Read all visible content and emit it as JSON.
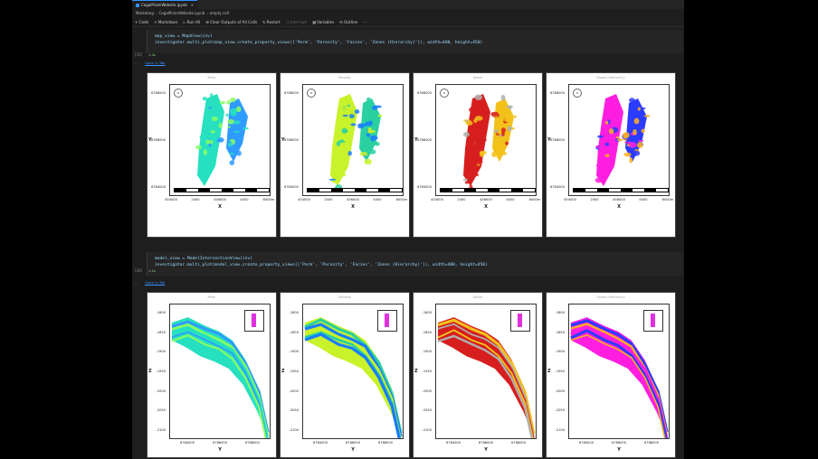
{
  "tab": {
    "filename": "CegalPrizmWebsite.ipynb"
  },
  "breadcrumb": [
    "Marketing",
    "CegalPrizmWebsite.ipynb",
    "empty cell"
  ],
  "toolbar": [
    {
      "label": "Code",
      "icon": "plus-icon",
      "enabled": true
    },
    {
      "label": "Markdown",
      "icon": "plus-icon",
      "enabled": true
    },
    {
      "label": "Run All",
      "icon": "run-all-icon",
      "enabled": true
    },
    {
      "label": "Clear Outputs of All Cells",
      "icon": "clear-icon",
      "enabled": true
    },
    {
      "label": "Restart",
      "icon": "restart-icon",
      "enabled": true
    },
    {
      "label": "Interrupt",
      "icon": "stop-icon",
      "enabled": false
    },
    {
      "label": "Variables",
      "icon": "variables-icon",
      "enabled": true
    },
    {
      "label": "Outline",
      "icon": "outline-icon",
      "enabled": true
    }
  ],
  "cells": [
    {
      "exec_count": "[35]",
      "status": "1.4s",
      "code_line1": "map_view = MapView(inv)",
      "code_line2": "investigator.multi_plot(map_view.create_property_views(['Perm', 'Porosity', 'Facies', 'Zones (Hierarchy)']), width=400, height=450)",
      "out_link": "Open in Tab",
      "panels": [
        {
          "title": "Perm"
        },
        {
          "title": "Porosity"
        },
        {
          "title": "Facies"
        },
        {
          "title": "Zones (Hierarchy)"
        }
      ],
      "yticks": [
        "6788000",
        "6786000",
        "6784000"
      ],
      "ylabel": "Y",
      "xticks": [
        "454000",
        "2000",
        "456000",
        "4000",
        "6000m"
      ],
      "xlabel": "X"
    },
    {
      "exec_count": "[36]",
      "status": "1.2s",
      "code_line1": "model_view = ModelIntersectionView(inv)",
      "code_line2": "investigator.multi_plot(model_view.create_property_views(['Perm', 'Porosity', 'Facies', 'Zones (Hierarchy)']), width=400, height=450)",
      "out_link": "Open in Tab",
      "panels": [
        {
          "title": "Perm"
        },
        {
          "title": "Porosity"
        },
        {
          "title": "Facies"
        },
        {
          "title": "Zones (Hierarchy)"
        }
      ],
      "yticks": [
        "-1800",
        "-1850",
        "-1900",
        "-1950",
        "-2000",
        "-2050",
        "-2100"
      ],
      "ylabel": "Z",
      "xticks": [
        "6784000",
        "6786000",
        "6788000"
      ],
      "xlabel": "Y"
    }
  ],
  "colors": {
    "perm": [
      "#26e0c0",
      "#2f9bff",
      "#8bff60"
    ],
    "porosity": [
      "#c8f22a",
      "#2ad0a0",
      "#1a7cff"
    ],
    "facies": [
      "#d71e1e",
      "#f2c21b",
      "#b0b0b0"
    ],
    "zones": [
      "#ff1ee0",
      "#2b3bff",
      "#ffb020"
    ]
  }
}
